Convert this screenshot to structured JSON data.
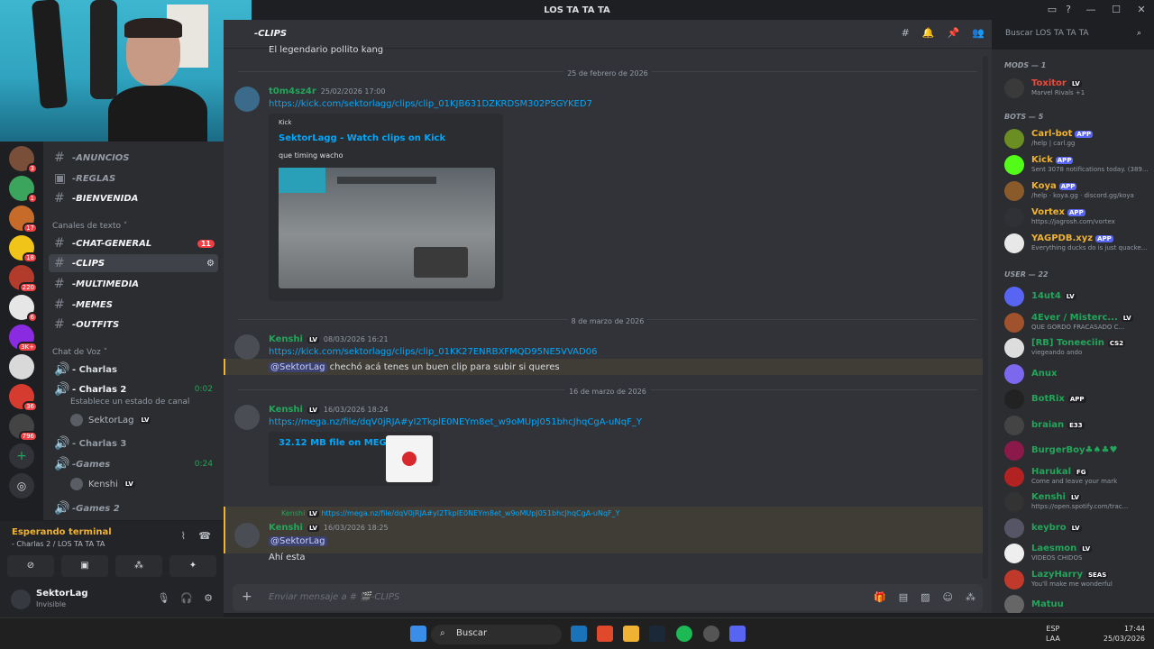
{
  "window": {
    "title": "LOS TA TA TA"
  },
  "guilds": [
    {
      "badge": "3",
      "color": "#7a4f3a"
    },
    {
      "badge": "1",
      "color": "#3ba55d"
    },
    {
      "badge": "17",
      "color": "#c76b2a"
    },
    {
      "badge": "18",
      "color": "#f0c419"
    },
    {
      "badge": "220",
      "color": "#b33b2b"
    },
    {
      "badge": "6",
      "color": "#e6e6e6"
    },
    {
      "badge": "3K+",
      "color": "#8a2be2"
    },
    {
      "badge": "",
      "color": "#d9d9d9"
    },
    {
      "badge": "36",
      "color": "#d63b2f"
    },
    {
      "badge": "796",
      "color": "#444"
    }
  ],
  "channels": {
    "items": [
      {
        "name": "-ANUNCIOS",
        "icon": "megaphone-icon"
      },
      {
        "name": "-REGLAS",
        "icon": "rules-icon"
      },
      {
        "name": "-BIENVENIDA",
        "icon": "welcome-icon"
      },
      {
        "name": "-CHAT-GENERAL",
        "badge": "11",
        "icon": "globe-icon"
      },
      {
        "name": "-CLIPS",
        "icon": "clapper-icon"
      },
      {
        "name": "-MULTIMEDIA",
        "icon": "picture-icon"
      },
      {
        "name": "-MEMES",
        "icon": "laugh-icon"
      },
      {
        "name": "-OUTFITS",
        "icon": "sunglasses-icon"
      }
    ],
    "cat_text": "Canales de texto",
    "cat_voice": "Chat de Voz",
    "voice": [
      {
        "name": "- Charlas"
      },
      {
        "name": "- Charlas 2",
        "timer": "0:02"
      },
      {
        "name": "- Charlas 3"
      },
      {
        "name": "-Games",
        "timer": "0:24"
      },
      {
        "name": "-Games 2"
      }
    ],
    "status_hint": "Establece un estado de canal",
    "voice_users": [
      {
        "name": "SektorLag",
        "tag": "LV"
      },
      {
        "name": "Kenshi",
        "tag": "LV"
      }
    ]
  },
  "voicepanel": {
    "status": "Esperando terminal",
    "route": "- Charlas 2 / LOS TA TA TA"
  },
  "user": {
    "name": "SektorLag",
    "status": "Invisible"
  },
  "main": {
    "channel": "-CLIPS",
    "first_line": "El legendario pollito kang",
    "date1": "25 de febrero de 2026",
    "m1": {
      "author": "t0m4sz4r",
      "ts": "25/02/2026 17:00",
      "link": "https://kick.com/sektorlagg/clips/clip_01KJB631DZKRDSM302PSGYKED7",
      "embed_provider": "Kick",
      "embed_title": "SektorLagg - Watch clips on Kick",
      "embed_desc": "que timing wacho"
    },
    "date2": "8 de marzo de 2026",
    "m2": {
      "author": "Kenshi",
      "tag": "LV",
      "ts": "08/03/2026 16:21",
      "link": "https://kick.com/sektorlagg/clips/clip_01KK27ENRBXFMQD95NE5VVAD06",
      "mention": "@SektorLag",
      "text": " chechó acá tenes un buen clip para subir si queres"
    },
    "date3": "16 de marzo de 2026",
    "m3": {
      "author": "Kenshi",
      "tag": "LV",
      "ts": "16/03/2026 18:24",
      "link": "https://mega.nz/file/dqV0jRJA#yI2TkplE0NEYm8et_w9oMUpJ051bhcJhqCgA-uNqF_Y",
      "file": "32.12 MB file on MEGA"
    },
    "m4": {
      "reply_author": "Kenshi",
      "reply_tag": "LV",
      "reply_link": "https://mega.nz/file/dqV0jRJA#yI2TkplE0NEYm8et_w9oMUpJ051bhcJhqCgA-uNqF_Y",
      "author": "Kenshi",
      "tag": "LV",
      "ts": "16/03/2026 18:25",
      "mention": "@SektorLag",
      "text": "Ahí esta"
    },
    "composer_placeholder": "Enviar mensaje a # 🎬-CLIPS"
  },
  "search": {
    "placeholder": "Buscar LOS TA TA TA"
  },
  "members": {
    "mods_label": "MODS — 1",
    "mods": [
      {
        "name": "Toxitor",
        "tag": "LV",
        "status": "Marvel Rivals +1"
      }
    ],
    "bots_label": "BOTS — 5",
    "bots": [
      {
        "name": "Carl-bot",
        "status": "/help | carl.gg",
        "color": "#6b8e23"
      },
      {
        "name": "Kick",
        "status": "Sent 3078 notifications today. (389...",
        "color": "#53fc18"
      },
      {
        "name": "Koya",
        "status": "/help · koya.gg · discord.gg/koya",
        "color": "#8b5a2b"
      },
      {
        "name": "Vortex",
        "status": "https://jagrosh.com/vortex",
        "color": "#2f3136"
      },
      {
        "name": "YAGPDB.xyz",
        "status": "Everything ducks do is just quacke...",
        "color": "#e8e8e8"
      }
    ],
    "users_label": "USER — 22",
    "users": [
      {
        "name": "14ut4",
        "tag": "LV",
        "status": "",
        "color": "#5865f2"
      },
      {
        "name": "4Ever / Misterc...",
        "tag": "LV",
        "status": "QUE GORDO FRACASADO C...",
        "color": "#a0522d"
      },
      {
        "name": "[RB] Toneeciin",
        "tag": "CS2",
        "status": "viegeando ando",
        "color": "#ddd"
      },
      {
        "name": "Anux",
        "tag": "",
        "status": "",
        "color": "#7b68ee"
      },
      {
        "name": "BotRix",
        "tag": "APP",
        "status": "",
        "color": "#222"
      },
      {
        "name": "braian",
        "tag": "E33",
        "status": "",
        "color": "#444"
      },
      {
        "name": "BurgerBoy♣♠♣♥",
        "tag": "",
        "status": "",
        "color": "#8b1a4a"
      },
      {
        "name": "Harukal",
        "tag": "FG",
        "status": "Come and leave your mark",
        "color": "#b22222"
      },
      {
        "name": "Kenshi",
        "tag": "LV",
        "status": "https://open.spotify.com/trac...",
        "color": "#333"
      },
      {
        "name": "keybro",
        "tag": "LV",
        "status": "",
        "color": "#556"
      },
      {
        "name": "Laesmon",
        "tag": "LV",
        "status": "VIDEOS CHIDOS",
        "color": "#eee"
      },
      {
        "name": "LazyHarry",
        "tag": "SEAS",
        "status": "You'll make me wonderful",
        "color": "#c0392b"
      },
      {
        "name": "Matuu",
        "tag": "",
        "status": "",
        "color": "#666"
      }
    ]
  },
  "taskbar": {
    "search": "Buscar",
    "lang1": "ESP",
    "lang2": "LAA",
    "time": "17:44",
    "date": "25/03/2026"
  }
}
